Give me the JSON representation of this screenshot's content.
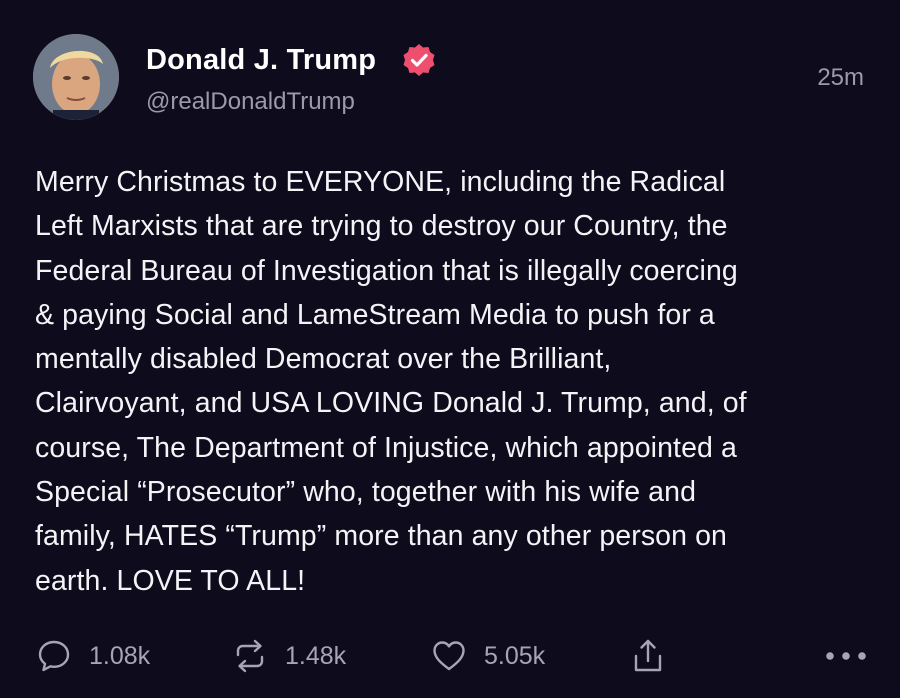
{
  "author": {
    "display_name": "Donald J. Trump",
    "handle": "@realDonaldTrump",
    "verified": true,
    "verified_badge_color": "#ee4f6f",
    "avatar": "profile-photo"
  },
  "timestamp": "25m",
  "post": {
    "lines": [
      "Merry Christmas to EVERYONE, including the Radical",
      "Left Marxists that are trying to destroy our Country, the",
      "Federal Bureau of Investigation that is illegally coercing",
      "& paying Social and LameStream Media to push for a",
      "mentally disabled Democrat over the Brilliant,",
      "Clairvoyant, and USA LOVING Donald J. Trump, and, of",
      "course, The Department of Injustice, which appointed a",
      "Special “Prosecutor” who, together with his wife and",
      "family, HATES “Trump” more than any other person on",
      "earth. LOVE TO ALL!"
    ]
  },
  "actions": {
    "reply": {
      "icon": "reply-bubble-icon",
      "count": "1.08k"
    },
    "repost": {
      "icon": "repost-arrows-icon",
      "count": "1.48k"
    },
    "like": {
      "icon": "heart-icon",
      "count": "5.05k"
    },
    "share": {
      "icon": "share-icon"
    },
    "more": {
      "icon": "more-dots-icon"
    }
  },
  "colors": {
    "background": "#0e0b1d",
    "text": "#f4f4f7",
    "secondary_text": "#9c9aa8"
  }
}
